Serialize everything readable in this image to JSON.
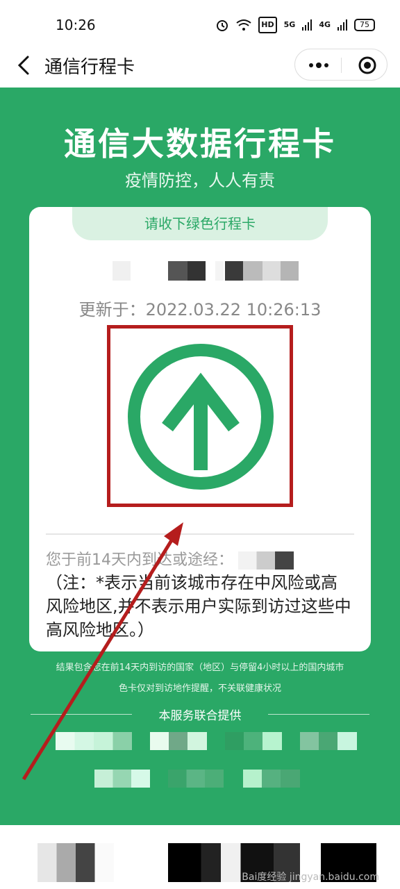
{
  "status_bar": {
    "time": "10:26",
    "hd_label": "HD",
    "sig1_label": "5G",
    "sig2_label": "4G",
    "battery": "75"
  },
  "nav": {
    "title": "通信行程卡"
  },
  "page": {
    "main_title": "通信大数据行程卡",
    "slogan": "疫情防控，人人有责",
    "card_tab": "请收下绿色行程卡",
    "update_line": "更新于：2022.03.22 10:26:13",
    "travel_prefix": "您于前14天内到达或途经：",
    "note": "（注：*表示当前该城市存在中风险或高风险地区,并不表示用户实际到访过这些中高风险地区。）",
    "footer_note_1": "结果包含您在前14天内到访的国家（地区）与停留4小时以上的国内城市",
    "footer_note_2": "色卡仅对到访地作提醒，不关联健康状况",
    "provider_label": "本服务联合提供"
  },
  "watermark": "Bai度经验 jingyan.baidu.com",
  "colors": {
    "green": "#2aa866",
    "highlight_red": "#b51d1d",
    "tab_bg": "#daf1e2"
  }
}
